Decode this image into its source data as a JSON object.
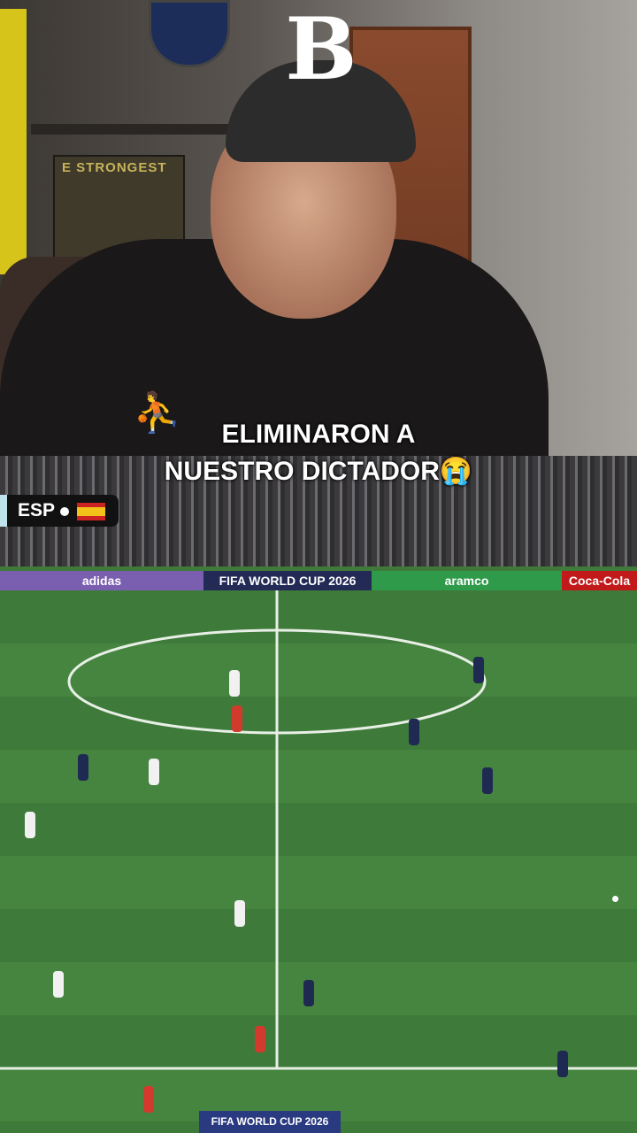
{
  "overlay": {
    "logo_letter": "B",
    "caption_line1": "ELIMINARON A",
    "caption_line2": "NUESTRO DICTADOR😭"
  },
  "webcam": {
    "banner_text": "E STRONGEST",
    "shirt_logo": "jumpman-icon"
  },
  "broadcast": {
    "team_abbr": "ESP",
    "team_flag": "spain-flag-icon",
    "ad_boards": [
      "adidas",
      "FIFA WORLD CUP 2026",
      "aramco",
      "Coca-Cola"
    ],
    "bottom_banner": "FIFA WORLD CUP 2026"
  },
  "colors": {
    "pitch_green": "#3f7a3a",
    "team_a_kit": "#f1f1f1",
    "team_b_kit": "#1f2a52",
    "referee_kit": "#d23a2e"
  }
}
